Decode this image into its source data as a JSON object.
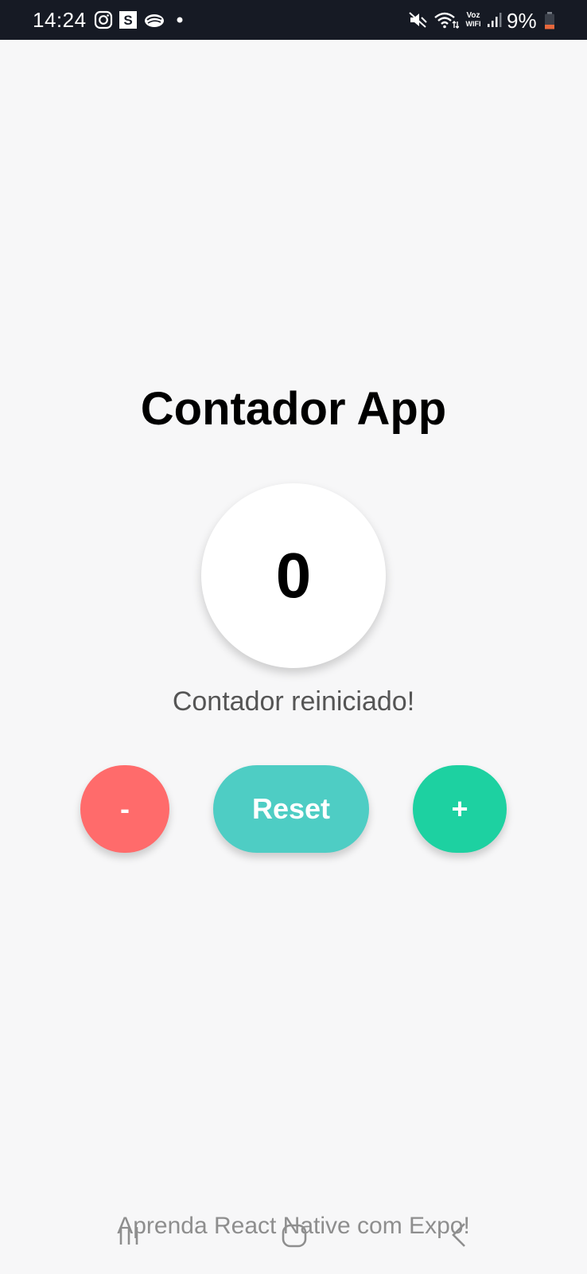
{
  "status_bar": {
    "time": "14:24",
    "battery": "9%",
    "voz_label_top": "Voz",
    "voz_label_bottom": "WiFi",
    "icons": [
      "instagram-icon",
      "s-app-icon",
      "cloud-app-icon",
      "notification-dot-icon",
      "mute-icon",
      "wifi-icon",
      "voz-wifi-icon",
      "signal-icon",
      "battery-icon"
    ]
  },
  "app": {
    "title": "Contador App",
    "count": "0",
    "message": "Contador reiniciado!",
    "buttons": {
      "decrement": "-",
      "reset": "Reset",
      "increment": "+"
    },
    "footer": "Aprenda React Native com Expo!"
  },
  "colors": {
    "status_bar_bg": "#161a24",
    "background": "#f7f7f8",
    "decrement": "#ff6b6b",
    "reset": "#4ecdc4",
    "increment": "#1dd1a1",
    "message": "#555555",
    "footer": "#8e8e8e"
  },
  "navigation": {
    "icons": [
      "recent-apps-icon",
      "home-icon",
      "back-icon"
    ]
  }
}
